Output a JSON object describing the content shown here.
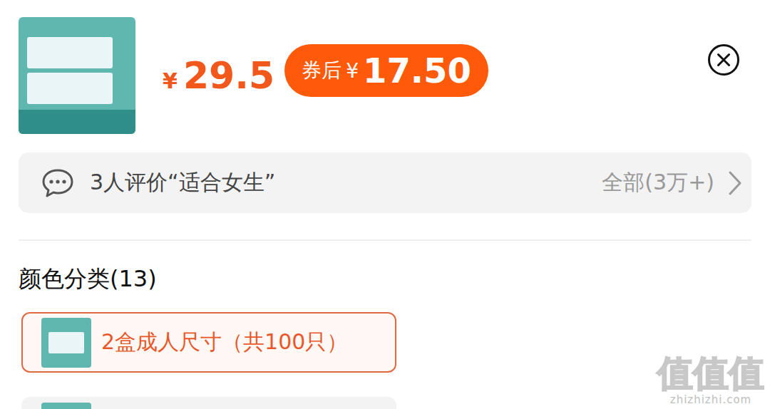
{
  "product": {
    "price_symbol": "¥",
    "price": "29.5",
    "coupon": {
      "label": "券后",
      "symbol": "¥",
      "price": "17.50"
    }
  },
  "review": {
    "summary": "3人评价“适合女生”",
    "all": "全部(3万+)"
  },
  "options": {
    "title": "颜色分类(13)",
    "items": [
      {
        "label": "2盒成人尺寸（共100只）",
        "selected": true
      },
      {
        "label": "",
        "selected": false
      }
    ]
  },
  "watermark": {
    "logo": "值值值",
    "site": "zhizhizhi.com"
  }
}
